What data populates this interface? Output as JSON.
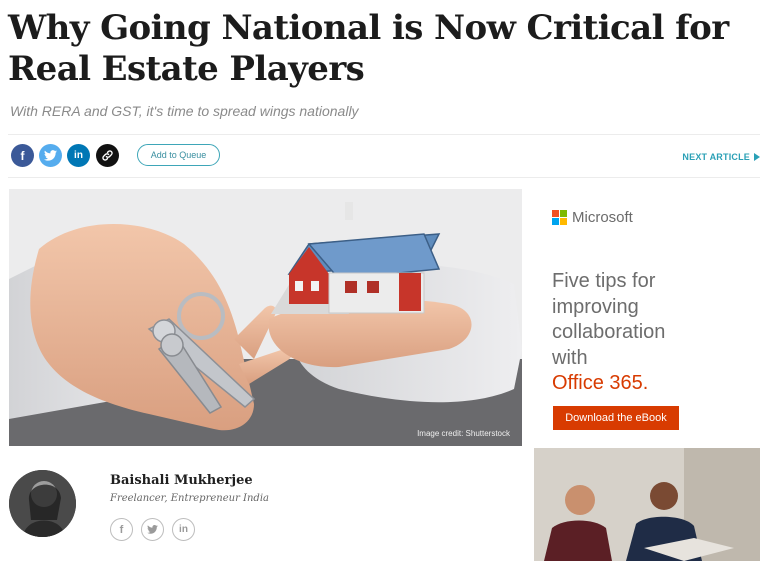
{
  "article": {
    "headline": "Why Going National is Now Critical for Real Estate Players",
    "subhead": "With RERA and GST, it's time to spread wings nationally"
  },
  "share": {
    "icons": [
      "facebook-icon",
      "twitter-icon",
      "linkedin-icon",
      "link-icon"
    ],
    "facebook_glyph": "f",
    "linkedin_glyph": "in",
    "queue_label": "Add to Queue",
    "next_label": "NEXT ARTICLE",
    "colors": {
      "facebook": "#3b5998",
      "twitter": "#55acee",
      "linkedin": "#0077b5",
      "link": "#111111",
      "accent": "#2aa0b6"
    }
  },
  "hero": {
    "credit": "Image credit: Shutterstock"
  },
  "ad": {
    "brand": "Microsoft",
    "line1": "Five tips for",
    "line2": "improving",
    "line3": "collaboration",
    "line4": "with",
    "line5": "Office 365.",
    "cta": "Download the eBook",
    "colors": {
      "accent": "#d83b01",
      "red": "#f25022",
      "green": "#7fba00",
      "blue": "#00a4ef",
      "yellow": "#ffb900"
    }
  },
  "author": {
    "name": "Baishali Mukherjee",
    "role": "Freelancer, Entrepreneur India",
    "social_icons": [
      "facebook-icon",
      "twitter-icon",
      "linkedin-icon"
    ],
    "facebook_glyph": "f",
    "linkedin_glyph": "in"
  }
}
